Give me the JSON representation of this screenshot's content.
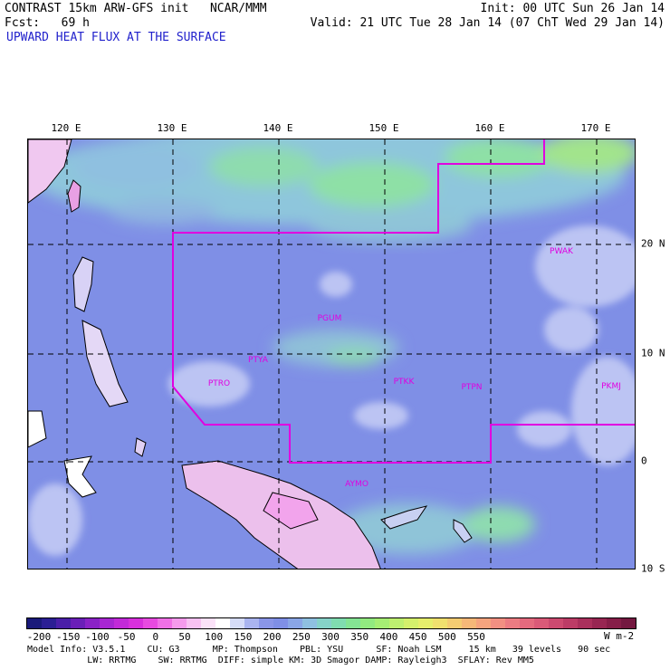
{
  "header": {
    "line1_left": "CONTRAST 15km ARW-GFS init   NCAR/MMM",
    "line1_right": "Init: 00 UTC Sun 26 Jan 14",
    "line2_left": "Fcst:   69 h",
    "line2_right": "Valid: 21 UTC Tue 28 Jan 14 (07 ChT Wed 29 Jan 14)",
    "field_title": "UPWARD HEAT FLUX AT THE SURFACE"
  },
  "colors": {
    "title_blue": "#2222cc",
    "boundary_magenta": "#e000e0",
    "background_flux": "#7f8fe6"
  },
  "map": {
    "lon_labels": [
      "120 E",
      "130 E",
      "140 E",
      "150 E",
      "160 E",
      "170 E"
    ],
    "lat_labels": [
      "20 N",
      "10 N",
      "0",
      "10 S"
    ],
    "stations": [
      "PWAK",
      "PGUM",
      "PTYA",
      "PTRO",
      "PTKK",
      "PTPN",
      "PKMJ",
      "AYMO"
    ]
  },
  "colorbar": {
    "unit": "W m-2",
    "tick_labels": [
      "-200",
      "-150",
      "-100",
      "-50",
      "0",
      "50",
      "100",
      "150",
      "200",
      "250",
      "300",
      "350",
      "400",
      "450",
      "500",
      "550"
    ],
    "colors": [
      "#1a1a7a",
      "#2b1f94",
      "#4a1fa8",
      "#6a1fb8",
      "#8a22c6",
      "#a826d2",
      "#c22ad8",
      "#d830dc",
      "#e84ae0",
      "#f070e6",
      "#f59aec",
      "#f8c2f2",
      "#fbe2f8",
      "#ffffff",
      "#d6dcf7",
      "#aab4ef",
      "#8a96e8",
      "#7f8fe6",
      "#8aa6e6",
      "#8fc0e0",
      "#86d2c8",
      "#80dcb0",
      "#84e494",
      "#92ea80",
      "#a6ee74",
      "#bef070",
      "#d4f06c",
      "#e6ee6c",
      "#f0e06e",
      "#f4cc72",
      "#f6b878",
      "#f6a47e",
      "#f29082",
      "#ec7c82",
      "#e46a7e",
      "#da5a78",
      "#cc4a70",
      "#bc3c66",
      "#aa305c",
      "#982652",
      "#861e48",
      "#741840"
    ]
  },
  "model_info": {
    "line1": "Model Info: V3.5.1    CU: G3      MP: Thompson    PBL: YSU      SF: Noah LSM     15 km   39 levels   90 sec",
    "line2": "           LW: RRTMG    SW: RRTMG  DIFF: simple KM: 3D Smagor DAMP: Rayleigh3  SFLAY: Rev MM5"
  }
}
